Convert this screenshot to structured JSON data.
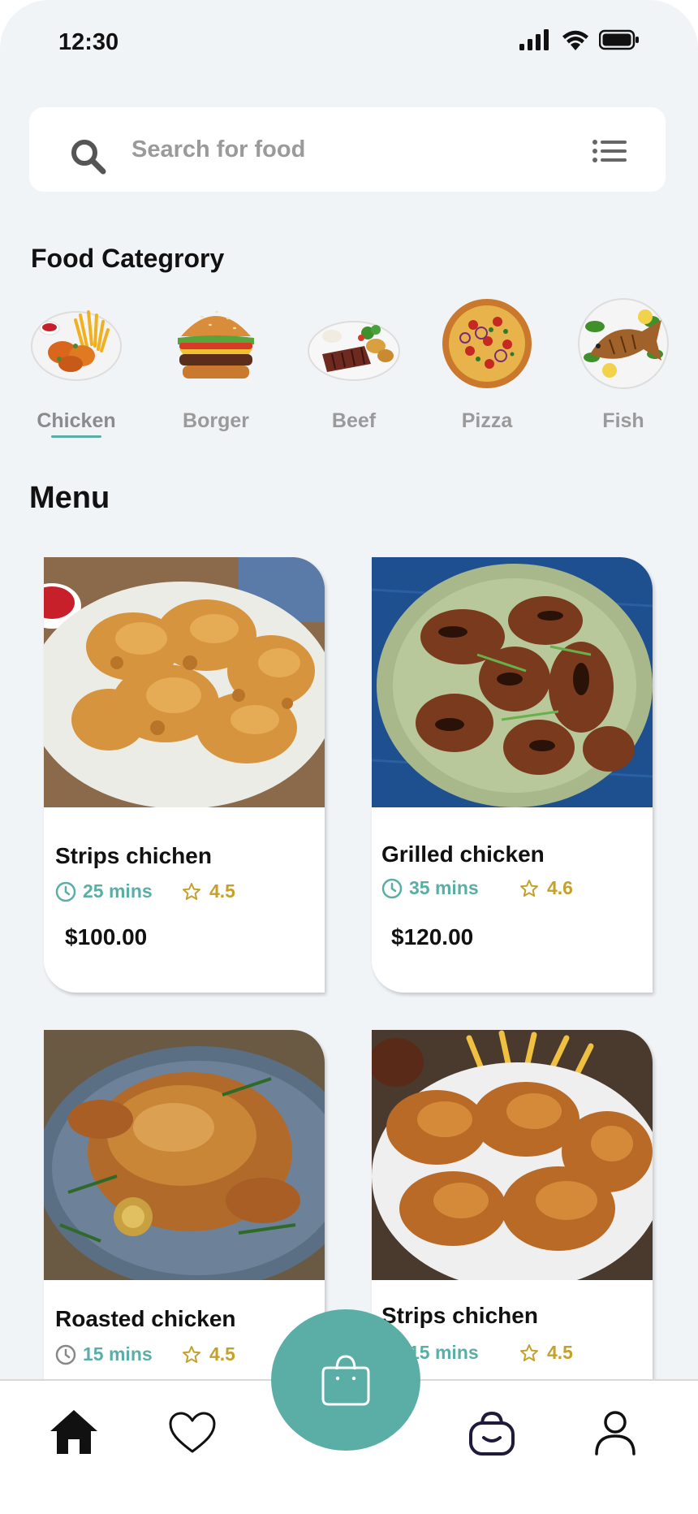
{
  "status_bar": {
    "time": "12:30"
  },
  "search": {
    "placeholder": "Search for food"
  },
  "category": {
    "title": "Food Categrory",
    "items": [
      {
        "label": "Chicken",
        "active": true
      },
      {
        "label": "Borger",
        "active": false
      },
      {
        "label": "Beef",
        "active": false
      },
      {
        "label": "Pizza",
        "active": false
      },
      {
        "label": "Fish",
        "active": false
      }
    ]
  },
  "menu": {
    "title": "Menu",
    "items": [
      {
        "name": "Strips chichen",
        "time": "25 mins",
        "rating": "4.5",
        "price": "$100.00"
      },
      {
        "name": "Grilled chicken",
        "time": "35 mins",
        "rating": "4.6",
        "price": "$120.00"
      },
      {
        "name": "Roasted chicken",
        "time": "15 mins",
        "rating": "4.5"
      },
      {
        "name": "Strips chichen",
        "time": "15 mins",
        "rating": "4.5"
      }
    ]
  },
  "nav": {
    "items": [
      "home-icon",
      "heart-icon",
      "bag-icon",
      "cart-icon",
      "user-icon"
    ],
    "active": "home"
  },
  "colors": {
    "accent": "#5aaea6",
    "rating": "#c5a02b",
    "background": "#f1f4f7"
  }
}
